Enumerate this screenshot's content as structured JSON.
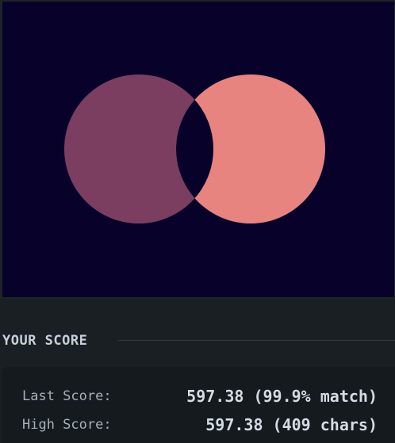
{
  "canvas": {
    "background_color": "#08022b",
    "left_circle_color": "#7b3e61",
    "right_circle_color": "#e78480",
    "overlap_color": "#08022b",
    "shape_icon": "two-overlapping-circles"
  },
  "score": {
    "title": "YOUR SCORE",
    "last_label": "Last Score:",
    "last_value": "597.38 (99.9% match)",
    "high_label": "High Score:",
    "high_value": "597.38 (409 chars)"
  }
}
